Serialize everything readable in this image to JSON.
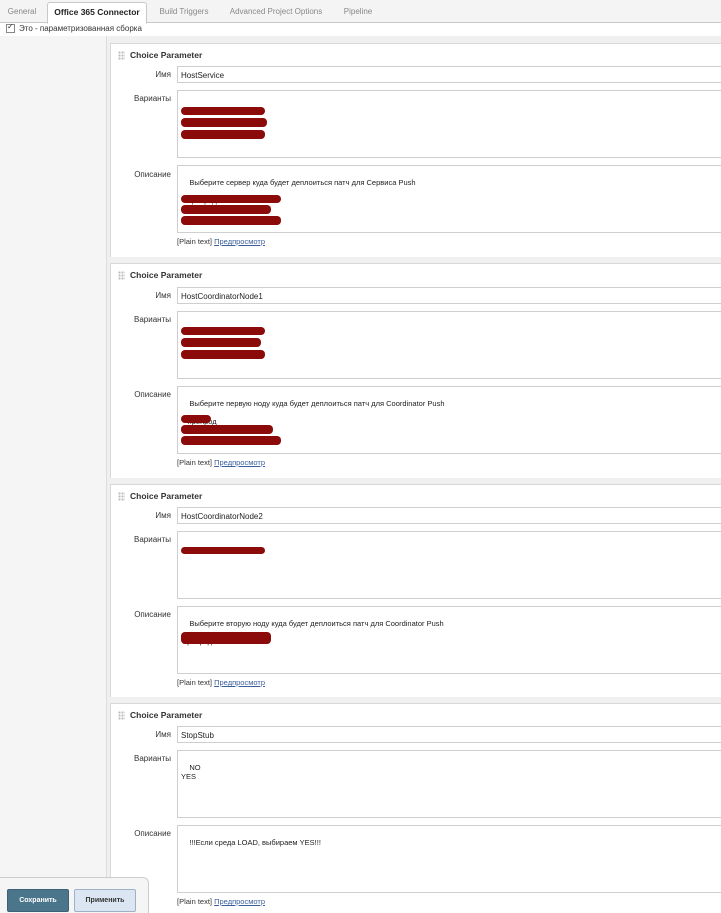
{
  "tabs": [
    "General",
    "Office 365 Connector",
    "Build Triggers",
    "Advanced Project Options",
    "Pipeline"
  ],
  "parameterized_label": "Это - параметризованная сборка",
  "labels": {
    "name": "Имя",
    "choices": "Варианты",
    "description": "Описание"
  },
  "footer": {
    "plain": "[Plain text]",
    "preview": "Предпросмотр"
  },
  "params": [
    {
      "title": "Choice Parameter",
      "name": "HostService",
      "choices": "-",
      "description": "Выберите сервер куда будет деплоиться патч для Сервиса Push\n\n - препрод\n - LOAD1\n - LOAD2"
    },
    {
      "title": "Choice Parameter",
      "name": "HostCoordinatorNode1",
      "choices": "-",
      "description": "Выберите первую ноду куда будет деплоиться патч для Coordinator Push\n\n - препрод\n - LOAD1\n - LOAD2"
    },
    {
      "title": "Choice Parameter",
      "name": "HostCoordinatorNode2",
      "choices": "-",
      "description": "Выберите вторую ноду куда будет деплоиться патч для Coordinator Push\n\n препрод"
    },
    {
      "title": "Choice Parameter",
      "name": "StopStub",
      "choices": "NO\nYES",
      "description": "!!!Если среда LOAD, выбираем YES!!!"
    }
  ],
  "buttons": {
    "save": "Сохранить",
    "apply": "Применить"
  },
  "colors": {
    "save_bg": "#4b758b",
    "apply_bg": "#dbe6f2",
    "link": "#3a5f9c",
    "redaction": "#8b0a0a"
  }
}
